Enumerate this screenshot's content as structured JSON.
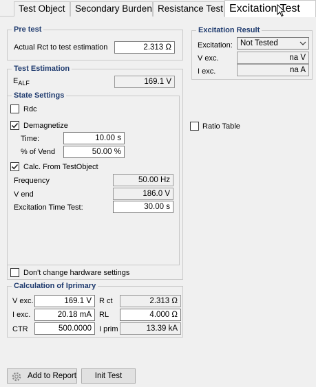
{
  "tabs": [
    {
      "label": "Test Object"
    },
    {
      "label": "Secondary Burden"
    },
    {
      "label": "Resistance Test"
    },
    {
      "label": "Excitation Test"
    }
  ],
  "pre_test": {
    "title": "Pre test",
    "rct_label": "Actual Rct to test estimation",
    "rct_value": "2.313 Ω"
  },
  "test_estimation": {
    "title": "Test Estimation",
    "ealf_label": "E",
    "ealf_sub": "ALF",
    "ealf_value": "169.1 V"
  },
  "state_settings": {
    "title": "State Settings",
    "rdc_label": "Rdc",
    "rdc_checked": false,
    "demagnetize_label": "Demagnetize",
    "demagnetize_checked": true,
    "time_label": "Time:",
    "time_value": "10.00 s",
    "vend_pct_label": "% of Vend",
    "vend_pct_value": "50.00 %",
    "calc_label": "Calc. From TestObject",
    "calc_checked": true,
    "frequency_label": "Frequency",
    "frequency_value": "50.00 Hz",
    "vend_label": "V end",
    "vend_value": "186.0 V",
    "exc_time_label": "Excitation Time Test:",
    "exc_time_value": "30.00 s"
  },
  "hardware": {
    "label": "Don't change hardware settings",
    "checked": false
  },
  "calc_iprimary": {
    "title": "Calculation of Iprimary",
    "vexc_label": "V exc.",
    "vexc_value": "169.1 V",
    "iexc_label": "I exc.",
    "iexc_value": "20.18 mA",
    "ctr_label": "CTR",
    "ctr_value": "500.0000",
    "rct_label": "R ct",
    "rct_value": "2.313 Ω",
    "rl_label": "RL",
    "rl_value": "4.000 Ω",
    "iprim_label": "I prim",
    "iprim_value": "13.39 kA"
  },
  "excitation_result": {
    "title": "Excitation Result",
    "excitation_label": "Excitation:",
    "excitation_value": "Not Tested",
    "vexc_label": "V exc.",
    "vexc_value": "na V",
    "iexc_label": "I exc.",
    "iexc_value": "na A"
  },
  "ratio_table": {
    "label": "Ratio Table",
    "checked": false
  },
  "buttons": {
    "add_to_report": "Add to Report",
    "init_test": "Init Test"
  }
}
